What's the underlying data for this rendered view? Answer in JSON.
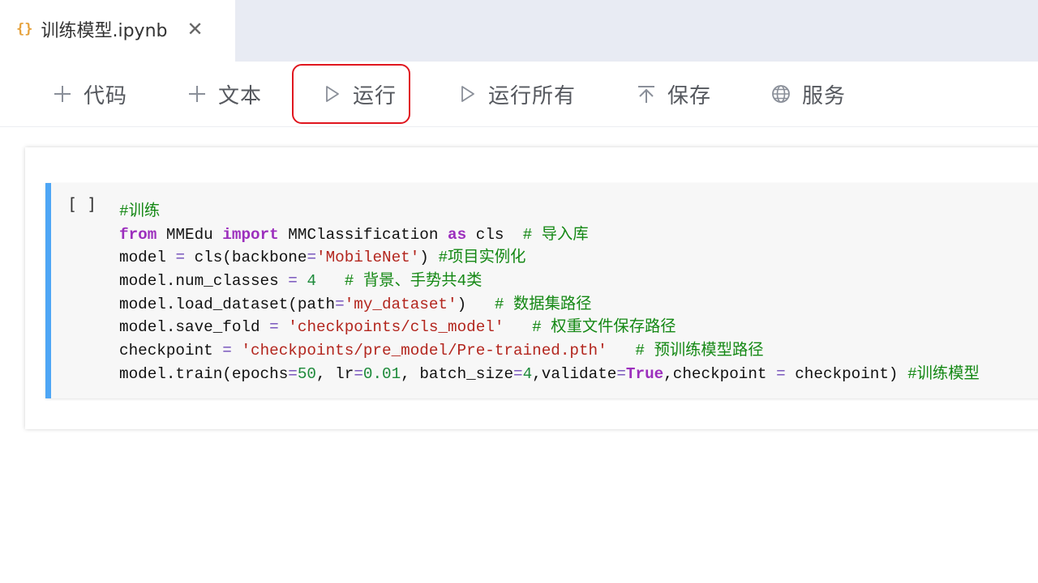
{
  "tab": {
    "icon": "{}",
    "title": "训练模型.ipynb",
    "close": "✕"
  },
  "toolbar": {
    "items": [
      {
        "label": "代码",
        "icon": "plus-icon"
      },
      {
        "label": "文本",
        "icon": "plus-icon"
      },
      {
        "label": "运行",
        "icon": "play-icon",
        "highlighted": true
      },
      {
        "label": "运行所有",
        "icon": "play-icon"
      },
      {
        "label": "保存",
        "icon": "upload-icon"
      },
      {
        "label": "服务",
        "icon": "globe-icon"
      }
    ],
    "highlight_color": "#e0161f"
  },
  "cell": {
    "prompt": "[ ]",
    "accent_color": "#4ea6f5",
    "lines": [
      [
        [
          "cmt",
          "#训练"
        ]
      ],
      [
        [
          "kw",
          "from"
        ],
        [
          "n",
          " MMEdu "
        ],
        [
          "kw",
          "import"
        ],
        [
          "n",
          " MMClassification "
        ],
        [
          "kw",
          "as"
        ],
        [
          "n",
          " cls  "
        ],
        [
          "cmt",
          "# 导入库"
        ]
      ],
      [
        [
          "n",
          "model "
        ],
        [
          "op",
          "="
        ],
        [
          "n",
          " cls(backbone"
        ],
        [
          "op",
          "="
        ],
        [
          "str",
          "'MobileNet'"
        ],
        [
          "n",
          ") "
        ],
        [
          "cmt",
          "#项目实例化"
        ]
      ],
      [
        [
          "n",
          "model.num_classes "
        ],
        [
          "op",
          "="
        ],
        [
          "n",
          " "
        ],
        [
          "num",
          "4"
        ],
        [
          "n",
          "   "
        ],
        [
          "cmt",
          "# 背景、手势共4类"
        ]
      ],
      [
        [
          "n",
          "model.load_dataset(path"
        ],
        [
          "op",
          "="
        ],
        [
          "str",
          "'my_dataset'"
        ],
        [
          "n",
          ")   "
        ],
        [
          "cmt",
          "# 数据集路径"
        ]
      ],
      [
        [
          "n",
          "model.save_fold "
        ],
        [
          "op",
          "="
        ],
        [
          "n",
          " "
        ],
        [
          "str",
          "'checkpoints/cls_model'"
        ],
        [
          "n",
          "   "
        ],
        [
          "cmt",
          "# 权重文件保存路径"
        ]
      ],
      [
        [
          "n",
          "checkpoint "
        ],
        [
          "op",
          "="
        ],
        [
          "n",
          " "
        ],
        [
          "str",
          "'checkpoints/pre_model/Pre-trained.pth'"
        ],
        [
          "n",
          "   "
        ],
        [
          "cmt",
          "# 预训练模型路径"
        ]
      ],
      [
        [
          "n",
          "model.train(epochs"
        ],
        [
          "op",
          "="
        ],
        [
          "num",
          "50"
        ],
        [
          "n",
          ", lr"
        ],
        [
          "op",
          "="
        ],
        [
          "num",
          "0.01"
        ],
        [
          "n",
          ", batch_size"
        ],
        [
          "op",
          "="
        ],
        [
          "num",
          "4"
        ],
        [
          "n",
          ",validate"
        ],
        [
          "op",
          "="
        ],
        [
          "kw",
          "True"
        ],
        [
          "n",
          ",checkpoint "
        ],
        [
          "op",
          "="
        ],
        [
          "n",
          " checkpoint) "
        ],
        [
          "cmt",
          "#训练模型"
        ]
      ]
    ]
  }
}
